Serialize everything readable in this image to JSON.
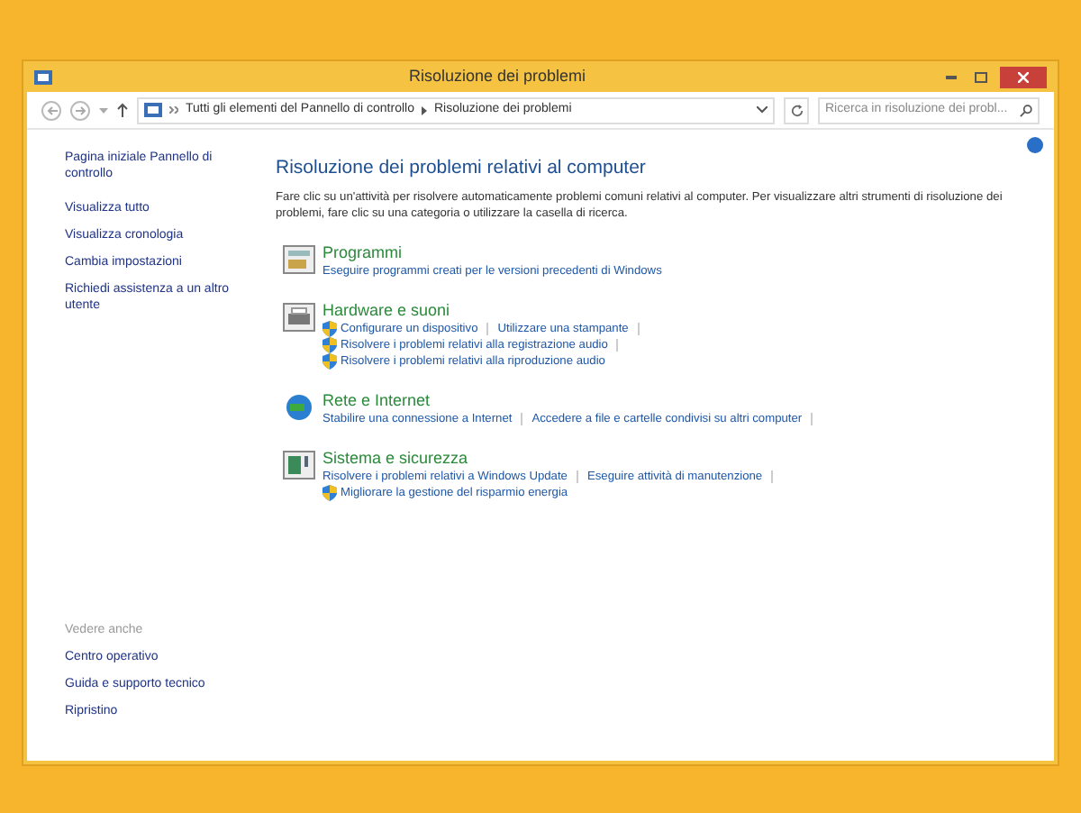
{
  "window": {
    "title": "Risoluzione dei problemi"
  },
  "address": {
    "path": [
      "Tutti gli elementi del Pannello di controllo",
      "Risoluzione dei problemi"
    ],
    "search_placeholder": "Ricerca in risoluzione dei probl..."
  },
  "sidebar": {
    "items": [
      "Pagina iniziale Pannello di controllo",
      "Visualizza tutto",
      "Visualizza cronologia",
      "Cambia impostazioni",
      "Richiedi assistenza a un altro utente"
    ],
    "see_also_heading": "Vedere anche",
    "see_also": [
      "Centro operativo",
      "Guida e supporto tecnico",
      "Ripristino"
    ]
  },
  "main": {
    "heading": "Risoluzione dei problemi relativi al computer",
    "description": "Fare clic su un'attività per risolvere automaticamente problemi comuni relativi al computer. Per visualizzare altri strumenti di risoluzione dei problemi, fare clic su una categoria o utilizzare la casella di ricerca.",
    "categories": [
      {
        "kind": "programs",
        "title": "Programmi",
        "rows": [
          [
            {
              "text": "Eseguire programmi creati per le versioni precedenti di Windows",
              "shield": false
            }
          ]
        ]
      },
      {
        "kind": "hardware",
        "title": "Hardware e suoni",
        "rows": [
          [
            {
              "text": "Configurare un dispositivo",
              "shield": true
            },
            {
              "text": "Utilizzare una stampante",
              "shield": false
            }
          ],
          [
            {
              "text": "Risolvere i problemi relativi alla registrazione audio",
              "shield": true
            }
          ],
          [
            {
              "text": "Risolvere i problemi relativi alla riproduzione audio",
              "shield": true
            }
          ]
        ]
      },
      {
        "kind": "network",
        "title": "Rete e Internet",
        "rows": [
          [
            {
              "text": "Stabilire una connessione a Internet",
              "shield": false
            },
            {
              "text": "Accedere a file e cartelle condivisi su altri computer",
              "shield": false
            }
          ]
        ]
      },
      {
        "kind": "system",
        "title": "Sistema e sicurezza",
        "rows": [
          [
            {
              "text": "Risolvere i problemi relativi a Windows Update",
              "shield": false
            },
            {
              "text": "Eseguire attività di manutenzione",
              "shield": false
            }
          ],
          [
            {
              "text": "Migliorare la gestione del risparmio energia",
              "shield": true
            }
          ]
        ]
      }
    ]
  }
}
